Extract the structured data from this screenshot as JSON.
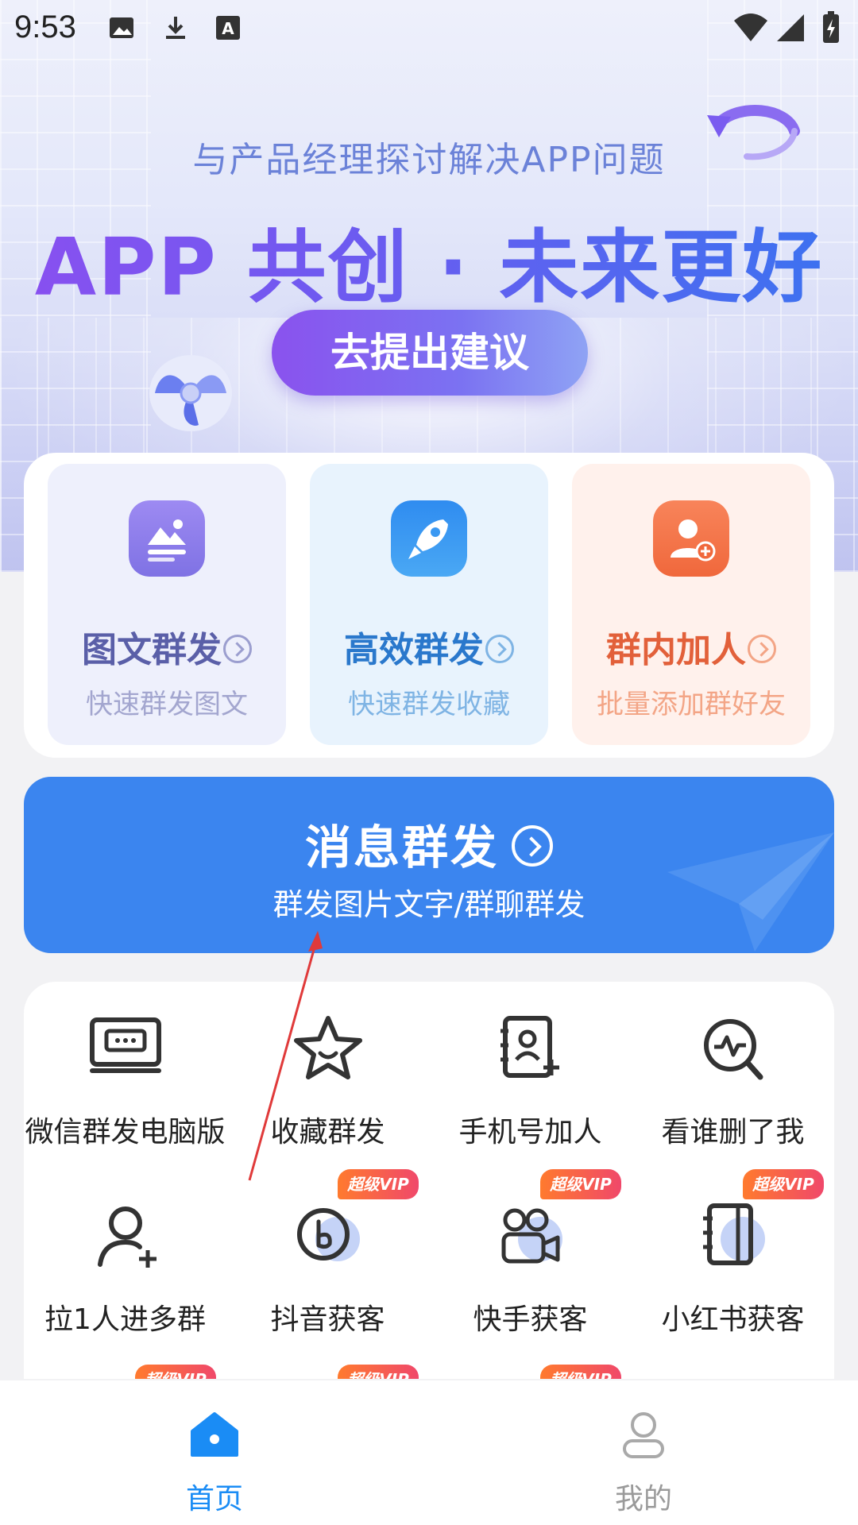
{
  "status_bar": {
    "time": "9:53"
  },
  "hero": {
    "subtitle": "与产品经理探讨解决APP问题",
    "title": "APP 共创 · 未来更好",
    "button_label": "去提出建议"
  },
  "features": [
    {
      "title": "图文群发",
      "desc": "快速群发图文",
      "color": "#5a5fa8",
      "desc_color": "#a3a6cf",
      "bg": "#eef0fc",
      "icon": "image-icon"
    },
    {
      "title": "高效群发",
      "desc": "快速群发收藏",
      "color": "#2a78cc",
      "desc_color": "#7fb4e4",
      "bg": "#e8f3fd",
      "icon": "rocket-icon"
    },
    {
      "title": "群内加人",
      "desc": "批量添加群好友",
      "color": "#e2603a",
      "desc_color": "#f3a586",
      "bg": "#fff1ec",
      "icon": "add-user-icon"
    }
  ],
  "message_banner": {
    "title": "消息群发",
    "subtitle": "群发图片文字/群聊群发"
  },
  "tools": [
    {
      "label": "微信群发电脑版",
      "icon": "monitor-icon",
      "vip": false
    },
    {
      "label": "收藏群发",
      "icon": "star-icon",
      "vip": false
    },
    {
      "label": "手机号加人",
      "icon": "contact-book-icon",
      "vip": false
    },
    {
      "label": "看谁删了我",
      "icon": "search-pulse-icon",
      "vip": false
    },
    {
      "label": "拉1人进多群",
      "icon": "add-person-icon",
      "vip": false
    },
    {
      "label": "抖音获客",
      "icon": "douyin-icon",
      "vip": true
    },
    {
      "label": "快手获客",
      "icon": "video-camera-icon",
      "vip": true
    },
    {
      "label": "小红书获客",
      "icon": "notebook-icon",
      "vip": true
    }
  ],
  "vip_badge": "超级VIP",
  "bottom_nav": [
    {
      "label": "首页",
      "icon": "home-icon",
      "active": true
    },
    {
      "label": "我的",
      "icon": "profile-icon",
      "active": false
    }
  ],
  "colors": {
    "accent_blue": "#3b85ef",
    "nav_active": "#1a8cf5",
    "nav_inactive": "#9a9a9a"
  }
}
